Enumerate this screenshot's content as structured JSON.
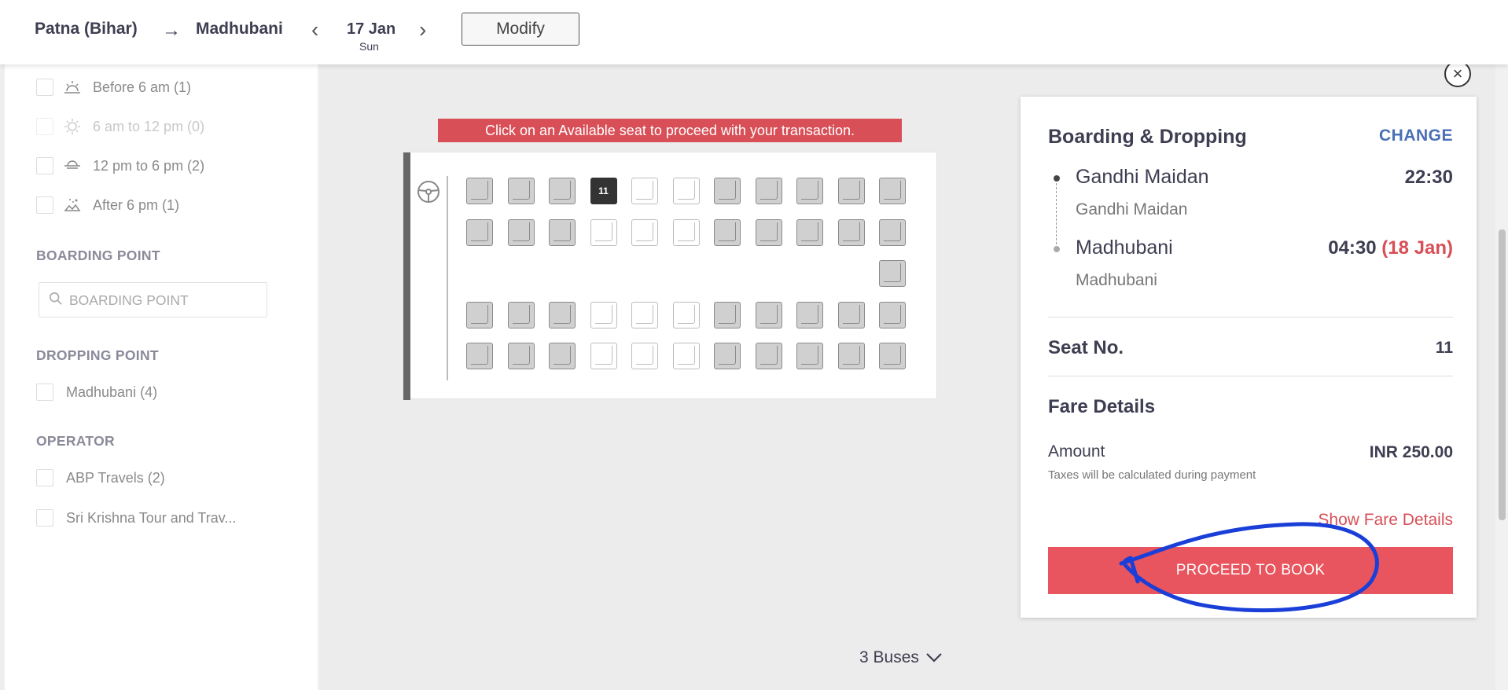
{
  "header": {
    "from": "Patna (Bihar)",
    "arrow": "→",
    "to": "Madhubani",
    "date": "17 Jan",
    "day": "Sun",
    "prev": "‹",
    "next": "›",
    "modify_label": "Modify"
  },
  "filters": {
    "departure": [
      {
        "label": "Before 6 am (1)",
        "icon": "sunrise-icon",
        "enabled": true
      },
      {
        "label": "6 am to 12 pm (0)",
        "icon": "sun-icon",
        "enabled": false
      },
      {
        "label": "12 pm to 6 pm (2)",
        "icon": "sunset-icon",
        "enabled": true
      },
      {
        "label": "After 6 pm (1)",
        "icon": "night-icon",
        "enabled": true
      }
    ],
    "boarding_title": "BOARDING POINT",
    "boarding_placeholder": "BOARDING POINT",
    "dropping_title": "DROPPING POINT",
    "dropping": [
      {
        "label": "Madhubani (4)"
      }
    ],
    "operator_title": "OPERATOR",
    "operators": [
      {
        "label": "ABP Travels (2)"
      },
      {
        "label": "Sri Krishna Tour and Trav..."
      }
    ]
  },
  "seat_map": {
    "banner": "Click on an Available seat to proceed with your transaction.",
    "selected_seat": "11",
    "rows": [
      [
        "booked",
        "booked",
        "booked",
        "selected",
        "avail",
        "avail",
        "booked",
        "booked",
        "booked",
        "booked",
        "booked"
      ],
      [
        "booked",
        "booked",
        "booked",
        "avail",
        "avail",
        "avail",
        "booked",
        "booked",
        "booked",
        "booked",
        "booked"
      ],
      [
        "",
        "",
        "",
        "",
        "",
        "",
        "",
        "",
        "",
        "",
        "booked"
      ],
      [
        "booked",
        "booked",
        "booked",
        "avail",
        "avail",
        "avail",
        "booked",
        "booked",
        "booked",
        "booked",
        "booked"
      ],
      [
        "booked",
        "booked",
        "booked",
        "avail",
        "avail",
        "avail",
        "booked",
        "booked",
        "booked",
        "booked",
        "booked"
      ]
    ]
  },
  "summary": {
    "title": "Boarding & Dropping",
    "change_label": "CHANGE",
    "boarding_name": "Gandhi Maidan",
    "boarding_sub": "Gandhi Maidan",
    "boarding_time": "22:30",
    "dropping_name": "Madhubani",
    "dropping_sub": "Madhubani",
    "dropping_time": "04:30",
    "dropping_date": "(18 Jan)",
    "seat_label": "Seat No.",
    "seat_value": "11",
    "fare_title": "Fare Details",
    "amount_label": "Amount",
    "amount_value": "INR 250.00",
    "tax_note": "Taxes will be calculated during payment",
    "show_fare_label": "Show Fare Details",
    "proceed_label": "PROCEED TO BOOK"
  },
  "footer": {
    "buses_label": "3 Buses"
  },
  "colors": {
    "accent_red": "#e8555e",
    "link_blue": "#4a6fb5",
    "annotation_blue": "#1a3fd8"
  }
}
